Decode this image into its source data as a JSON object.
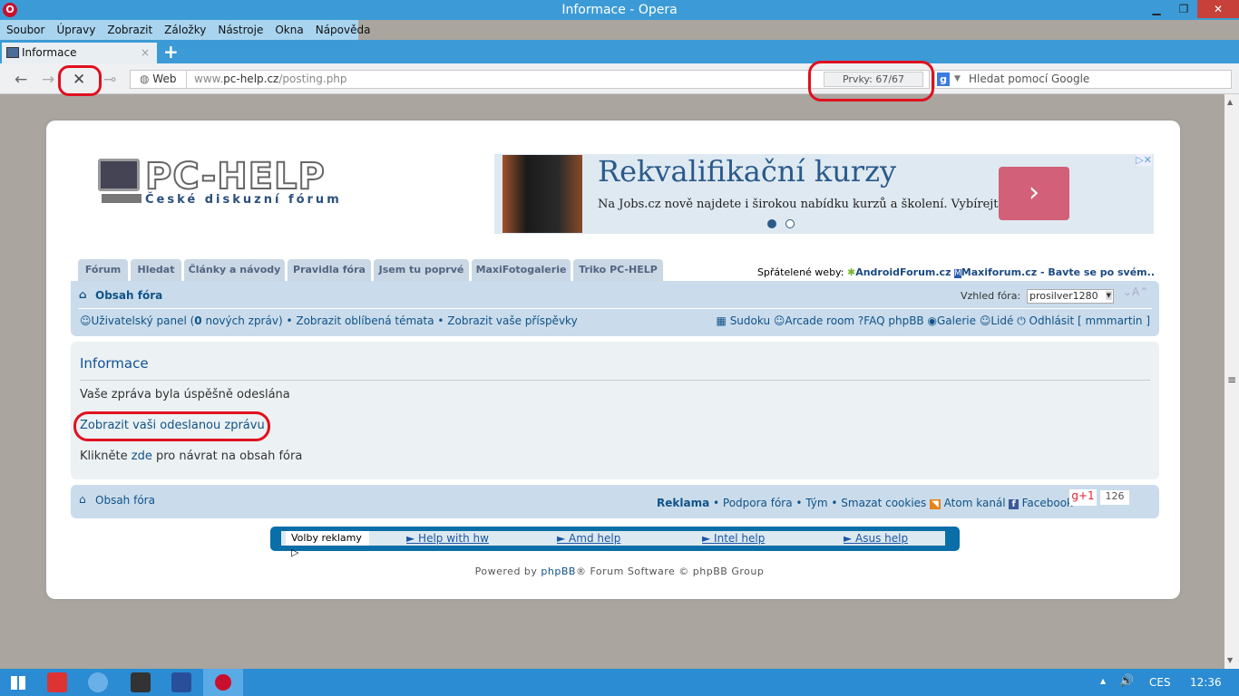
{
  "window": {
    "title": "Informace - Opera",
    "min": "▁",
    "max": "❐",
    "close": "✕"
  },
  "menu": [
    "Soubor",
    "Úpravy",
    "Zobrazit",
    "Záložky",
    "Nástroje",
    "Okna",
    "Nápověda"
  ],
  "tab": {
    "label": "Informace",
    "close": "×",
    "new": "+"
  },
  "toolbar": {
    "back": "←",
    "forward": "→",
    "stop": "✕",
    "key": "⊸",
    "web_label": "Web",
    "url_prefix": "www.",
    "url_domain": "pc-help.cz",
    "url_path": "/posting.php",
    "prvky": "Prvky:   67/67",
    "search_placeholder": "Hledat pomocí Google",
    "g": "g"
  },
  "logo": {
    "text": "PC-HELP",
    "sub": "České diskuzní fórum"
  },
  "ad": {
    "title": "Rekvalifikační kurzy",
    "text": "Na Jobs.cz nově najdete i širokou nabídku kurzů a školení. Vybírejte!",
    "arrow": "›",
    "badge": "▷✕"
  },
  "forum_tabs": [
    "Fórum",
    "Hledat",
    "Články a návody",
    "Pravidla fóra",
    "Jsem tu poprvé",
    "MaxiFotogalerie",
    "Triko PC-HELP"
  ],
  "friends": {
    "label": "Spřátelené weby:",
    "sites": [
      "AndroidForum.cz",
      "Maxiforum.cz - Bavte se po svém.."
    ]
  },
  "navbar": {
    "index": "Obsah fóra",
    "style_label": "Vzhled fóra:",
    "style_value": "prosilver1280",
    "font_size": "⌄A⌃",
    "user_panel": "Uživatelský panel (",
    "new_count": "0",
    "new_msgs": " nových zpráv)",
    "fav": "Zobrazit oblíbená témata",
    "posts": "Zobrazit vaše příspěvky",
    "right": [
      "Sudoku",
      "Arcade room",
      "FAQ phpBB",
      "Galerie",
      "Lidé",
      "Odhlásit [ mmmartin ]"
    ]
  },
  "panel": {
    "title": "Informace",
    "msg": "Vaše zpráva byla úspěšně odeslána",
    "view_link": "Zobrazit vaši odeslanou zprávu",
    "return_pre": "Klikněte ",
    "return_link": "zde",
    "return_post": " pro návrat na obsah fóra"
  },
  "footer": {
    "index": "Obsah fóra",
    "links": [
      "Reklama",
      "Podpora fóra",
      "Tým",
      "Smazat cookies",
      "Atom kanál",
      "Facebook"
    ],
    "gplus": "g+1",
    "gcount": "126"
  },
  "adbar": {
    "volby": "Volby reklamy ▷",
    "links": [
      "► Help with hw",
      "► Amd help",
      "► Intel help",
      "► Asus help"
    ]
  },
  "powered": {
    "pre": "Powered by ",
    "link": "phpBB",
    "post": "® Forum Software © phpBB Group"
  },
  "taskbar": {
    "lang": "CES",
    "time": "12:36",
    "tray_up": "▲",
    "volume": "🔊"
  }
}
